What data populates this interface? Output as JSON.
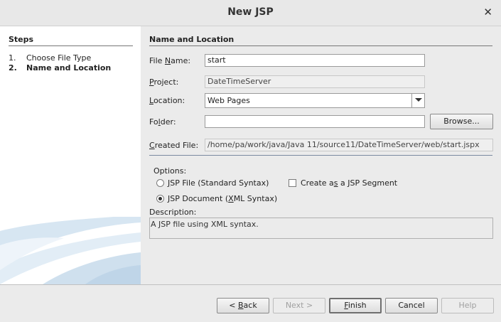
{
  "window": {
    "title": "New JSP"
  },
  "steps": {
    "header": "Steps",
    "items": [
      {
        "num": "1.",
        "label": "Choose File Type"
      },
      {
        "num": "2.",
        "label": "Name and Location"
      }
    ]
  },
  "panel": {
    "header": "Name and Location",
    "file_name": {
      "label_pre": "File ",
      "label_key": "N",
      "label_post": "ame:",
      "value": "start"
    },
    "project": {
      "label_pre": "",
      "label_key": "P",
      "label_post": "roject:",
      "value": "DateTimeServer"
    },
    "location": {
      "label_pre": "",
      "label_key": "L",
      "label_post": "ocation:",
      "value": "Web Pages"
    },
    "folder": {
      "label_pre": "Fo",
      "label_key": "l",
      "label_post": "der:",
      "value": "",
      "browse": "Browse..."
    },
    "created_file": {
      "label_pre": "",
      "label_key": "C",
      "label_post": "reated File:",
      "value": "/home/pa/work/java/Java 11/source11/DateTimeServer/web/start.jspx"
    },
    "options": {
      "label": "Options:",
      "jsp_file_pre": "",
      "jsp_file_key": "J",
      "jsp_file_post": "SP File (Standard Syntax)",
      "jsp_doc_pre": "JSP Document (",
      "jsp_doc_key": "X",
      "jsp_doc_post": "ML Syntax)",
      "segment_pre": "Create a",
      "segment_key": "s",
      "segment_post": " a JSP Segment"
    },
    "description": {
      "label": "Description:",
      "text": "A JSP file using XML syntax."
    }
  },
  "buttons": {
    "back_pre": "< ",
    "back_key": "B",
    "back_post": "ack",
    "next": "Next >",
    "finish_key": "F",
    "finish_post": "inish",
    "cancel": "Cancel",
    "help": "Help"
  }
}
